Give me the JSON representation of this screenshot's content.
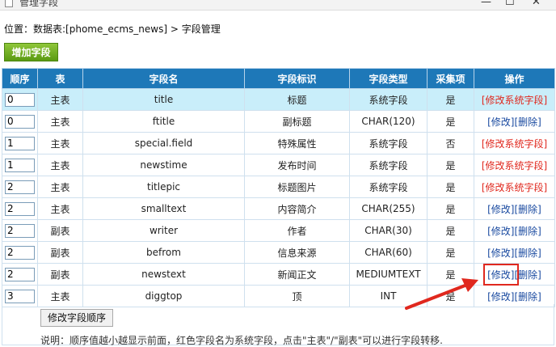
{
  "window": {
    "title": "管理字段",
    "minimize": "—",
    "maximize": "☐",
    "close": "✕"
  },
  "location": "位置：数据表:[phome_ecms_news] > 字段管理",
  "add_button": "增加字段",
  "columns": [
    "顺序",
    "表",
    "字段名",
    "字段标识",
    "字段类型",
    "采集项",
    "操作"
  ],
  "rows": [
    {
      "order": "0",
      "table": "主表",
      "name": "title",
      "label": "标题",
      "type": "系统字段",
      "collect": "是",
      "sys": true
    },
    {
      "order": "0",
      "table": "主表",
      "name": "ftitle",
      "label": "副标题",
      "type": "CHAR(120)",
      "collect": "是",
      "sys": false
    },
    {
      "order": "1",
      "table": "主表",
      "name": "special.field",
      "label": "特殊属性",
      "type": "系统字段",
      "collect": "否",
      "sys": true
    },
    {
      "order": "1",
      "table": "主表",
      "name": "newstime",
      "label": "发布时间",
      "type": "系统字段",
      "collect": "是",
      "sys": true
    },
    {
      "order": "2",
      "table": "主表",
      "name": "titlepic",
      "label": "标题图片",
      "type": "系统字段",
      "collect": "是",
      "sys": true
    },
    {
      "order": "2",
      "table": "主表",
      "name": "smalltext",
      "label": "内容简介",
      "type": "CHAR(255)",
      "collect": "是",
      "sys": false
    },
    {
      "order": "2",
      "table": "副表",
      "name": "writer",
      "label": "作者",
      "type": "CHAR(30)",
      "collect": "是",
      "sys": false
    },
    {
      "order": "2",
      "table": "副表",
      "name": "befrom",
      "label": "信息来源",
      "type": "CHAR(60)",
      "collect": "是",
      "sys": false
    },
    {
      "order": "2",
      "table": "副表",
      "name": "newstext",
      "label": "新闻正文",
      "type": "MEDIUMTEXT",
      "collect": "是",
      "sys": false
    },
    {
      "order": "3",
      "table": "主表",
      "name": "diggtop",
      "label": "顶",
      "type": "INT",
      "collect": "是",
      "sys": false
    }
  ],
  "actions": {
    "edit_sys": "[修改系统字段]",
    "edit": "[修改]",
    "delete": "[删除]"
  },
  "order_button": "修改字段顺序",
  "note": "说明：顺序值越小越显示前面，红色字段名为系统字段，点击\"主表\"/\"副表\"可以进行字段转移.",
  "colors": {
    "header_bg": "#1e78b8",
    "system_red": "#e0281e",
    "link_blue": "#1a4aa0",
    "highlight_row": "#c9eefa",
    "add_green": "#6aa81e"
  },
  "highlighted_row_index": 0,
  "boxed_edit_row_index": 8
}
